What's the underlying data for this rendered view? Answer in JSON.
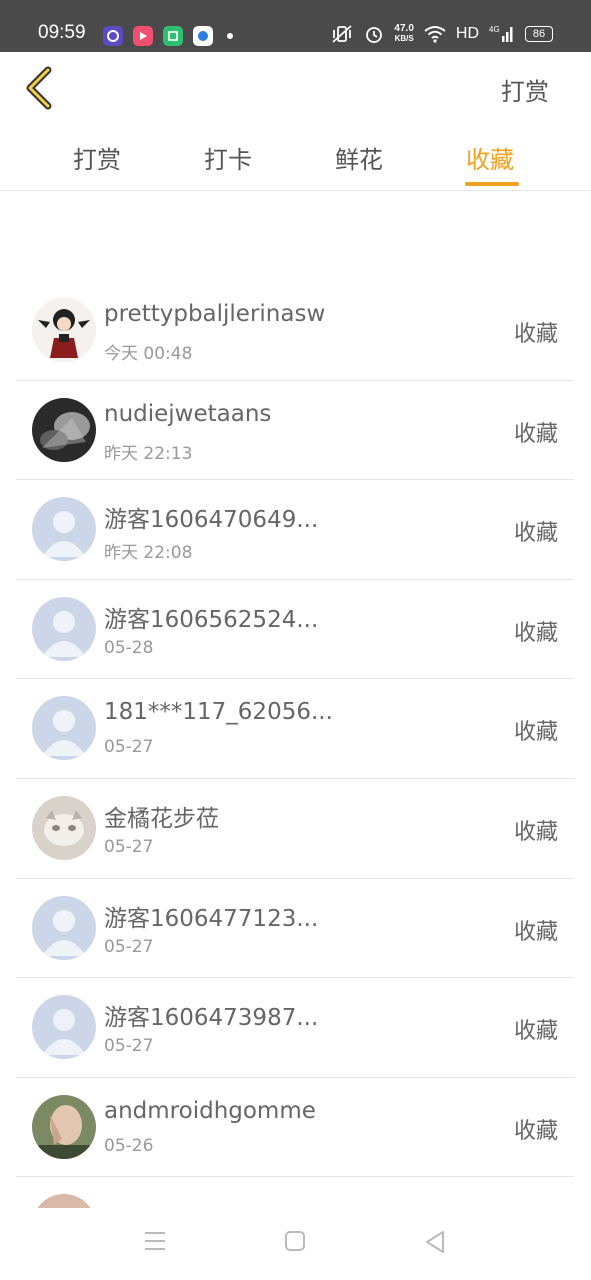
{
  "status_bar": {
    "time": "09:59",
    "net_speed_value": "47.0",
    "net_speed_unit": "KB/S",
    "hd": "HD",
    "signal": "4G",
    "battery": "86"
  },
  "header": {
    "action_label": "打赏"
  },
  "tabs": [
    {
      "label": "打赏",
      "active": false
    },
    {
      "label": "打卡",
      "active": false
    },
    {
      "label": "鲜花",
      "active": false
    },
    {
      "label": "收藏",
      "active": true
    }
  ],
  "colors": {
    "accent": "#f2a120",
    "status_bar_bg": "#4a4a4a",
    "divider": "#e5e5e5"
  },
  "list": [
    {
      "name": "prettypbaljlerinasw",
      "time": "今天 00:48",
      "type": "收藏",
      "avatar": "anime-character-avatar"
    },
    {
      "name": "nudiejwetaans",
      "time": "昨天 22:13",
      "type": "收藏",
      "avatar": "dark-photo-avatar"
    },
    {
      "name": "游客1606470649...",
      "time": "昨天 22:08",
      "type": "收藏",
      "avatar": "default-user-avatar"
    },
    {
      "name": "游客1606562524...",
      "time": "05-28",
      "type": "收藏",
      "avatar": "default-user-avatar"
    },
    {
      "name": "181***117_62056...",
      "time": "05-27",
      "type": "收藏",
      "avatar": "default-user-avatar"
    },
    {
      "name": "金橘花步莅",
      "time": "05-27",
      "type": "收藏",
      "avatar": "cat-photo-avatar"
    },
    {
      "name": "游客1606477123...",
      "time": "05-27",
      "type": "收藏",
      "avatar": "default-user-avatar"
    },
    {
      "name": "游客1606473987...",
      "time": "05-27",
      "type": "收藏",
      "avatar": "default-user-avatar"
    },
    {
      "name": "andmroidhgomme",
      "time": "05-26",
      "type": "收藏",
      "avatar": "hands-photo-avatar"
    }
  ]
}
